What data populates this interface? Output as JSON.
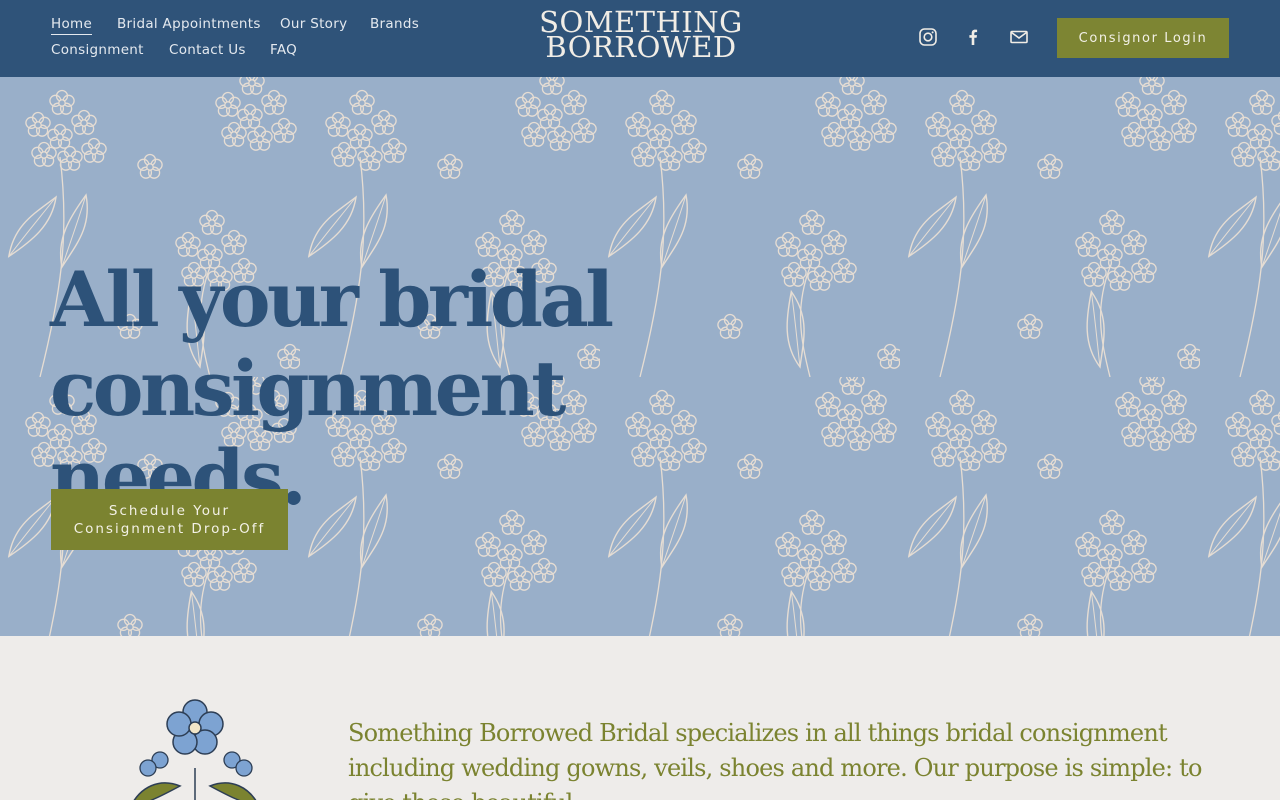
{
  "nav": {
    "items": [
      {
        "label": "Home",
        "active": true
      },
      {
        "label": "Bridal Appointments"
      },
      {
        "label": "Our Story"
      },
      {
        "label": "Brands"
      },
      {
        "label": "Consignment"
      },
      {
        "label": "Contact Us"
      },
      {
        "label": "FAQ"
      }
    ]
  },
  "logo": {
    "line1": "SOMETHING",
    "line2": "BORROWED"
  },
  "social": [
    {
      "name": "instagram-icon"
    },
    {
      "name": "facebook-icon"
    },
    {
      "name": "email-icon"
    }
  ],
  "header_button": {
    "label": "Consignor Login"
  },
  "hero": {
    "title_line1": "All your bridal",
    "title_line2": "consignment needs.",
    "cta_label": "Schedule Your Consignment Drop-Off"
  },
  "intro": {
    "text": "Something Borrowed Bridal specializes in all things bridal consignment including wedding gowns, veils, shoes and more. Our purpose is simple: to give these beautiful"
  },
  "colors": {
    "header": "#2f5379",
    "hero_bg": "#99afc9",
    "accent": "#7d8533",
    "body_bg": "#eeecea",
    "title": "#2d5279"
  }
}
